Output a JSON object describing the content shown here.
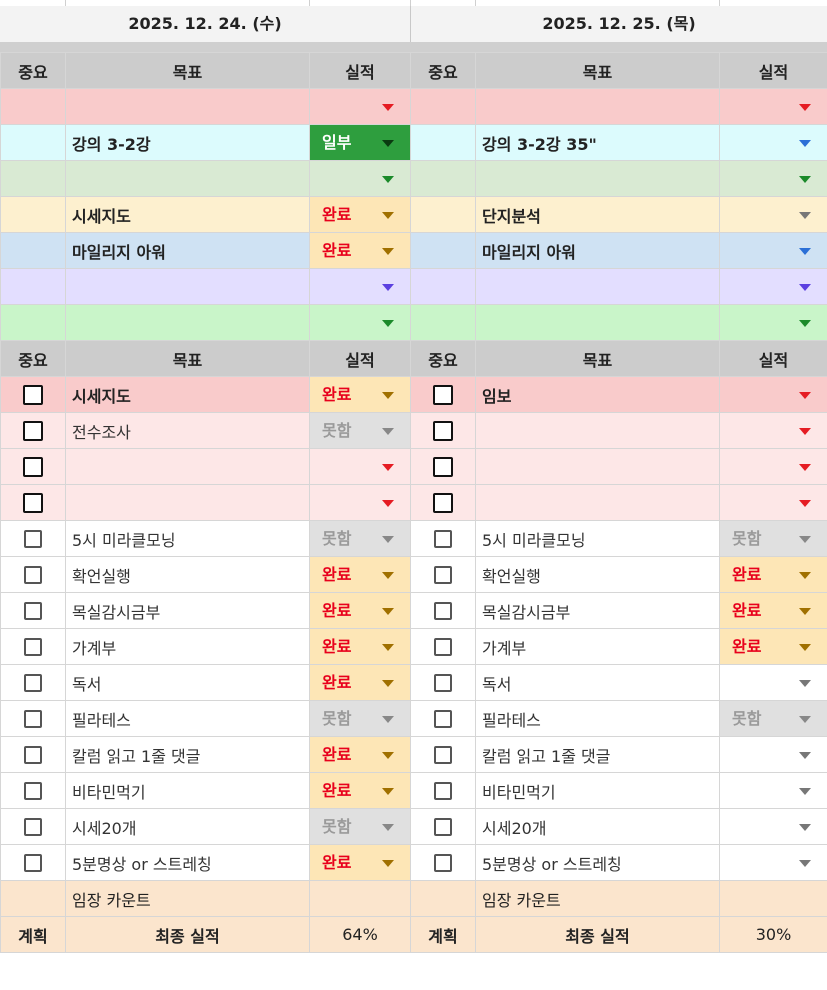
{
  "dates": [
    "2025. 12. 24. (수)",
    "2025. 12. 25. (목)"
  ],
  "headers": {
    "importance": "중요",
    "goal": "목표",
    "result": "실적"
  },
  "colors": {
    "red_row": "#f9cbcb",
    "cyan_row": "#dcfbfd",
    "green_row": "#d9ead3",
    "yellow_row": "#fdf0cf",
    "blue_row": "#cfe2f3",
    "purple_row": "#e3deff",
    "lightgreen_row": "#c9f5c9",
    "pink_row": "#fde7e7",
    "header_gray": "#cccccc",
    "footer": "#fbe5cd",
    "done_fill": "#fde6b6",
    "part_fill": "#2e9e3e"
  },
  "top_rows": [
    {
      "bg": "#f9cbcb",
      "day1": {
        "goal": "",
        "result": "",
        "arrow": "red"
      },
      "day2": {
        "goal": "",
        "result": "",
        "arrow": "red"
      }
    },
    {
      "bg": "#dcfbfd",
      "day1": {
        "goal": "강의 3-2강",
        "result": "일부",
        "arrow": "part"
      },
      "day2": {
        "goal": "강의 3-2강 35\"",
        "result": "",
        "arrow": "blue"
      }
    },
    {
      "bg": "#d9ead3",
      "day1": {
        "goal": "",
        "result": "",
        "arrow": "grn"
      },
      "day2": {
        "goal": "",
        "result": "",
        "arrow": "grn"
      }
    },
    {
      "bg": "#fdf0cf",
      "day1": {
        "goal": "시세지도",
        "result": "완료",
        "arrow": "done"
      },
      "day2": {
        "goal": "단지분석",
        "result": "",
        "arrow": "gray"
      }
    },
    {
      "bg": "#cfe2f3",
      "day1": {
        "goal": "마일리지 아워",
        "result": "완료",
        "arrow": "done"
      },
      "day2": {
        "goal": "마일리지 아워",
        "result": "",
        "arrow": "blue"
      }
    },
    {
      "bg": "#e3deff",
      "day1": {
        "goal": "",
        "result": "",
        "arrow": "pur"
      },
      "day2": {
        "goal": "",
        "result": "",
        "arrow": "pur"
      }
    },
    {
      "bg": "#c9f5c9",
      "day1": {
        "goal": "",
        "result": "",
        "arrow": "grn"
      },
      "day2": {
        "goal": "",
        "result": "",
        "arrow": "grn"
      }
    }
  ],
  "task_rows": [
    {
      "bg1": "#f9cbcb",
      "bg2": "#f9cbcb",
      "heavy": true,
      "bold": true,
      "day1": {
        "goal": "시세지도",
        "result": "완료",
        "arrow": "done"
      },
      "day2": {
        "goal": "임보",
        "result": "",
        "arrow": "red"
      }
    },
    {
      "bg1": "#fde7e7",
      "bg2": "#fde7e7",
      "heavy": true,
      "bold": false,
      "day1": {
        "goal": "전수조사",
        "result": "못함",
        "arrow": "fail"
      },
      "day2": {
        "goal": "",
        "result": "",
        "arrow": "red"
      }
    },
    {
      "bg1": "#fde7e7",
      "bg2": "#fde7e7",
      "heavy": true,
      "bold": false,
      "day1": {
        "goal": "",
        "result": "",
        "arrow": "red"
      },
      "day2": {
        "goal": "",
        "result": "",
        "arrow": "red"
      }
    },
    {
      "bg1": "#fde7e7",
      "bg2": "#fde7e7",
      "heavy": true,
      "bold": false,
      "day1": {
        "goal": "",
        "result": "",
        "arrow": "red"
      },
      "day2": {
        "goal": "",
        "result": "",
        "arrow": "red"
      }
    },
    {
      "bg1": "#ffffff",
      "bg2": "#ffffff",
      "heavy": false,
      "bold": false,
      "day1": {
        "goal": "5시 미라클모닝",
        "result": "못함",
        "arrow": "fail"
      },
      "day2": {
        "goal": "5시 미라클모닝",
        "result": "못함",
        "arrow": "fail"
      }
    },
    {
      "bg1": "#ffffff",
      "bg2": "#ffffff",
      "heavy": false,
      "bold": false,
      "day1": {
        "goal": "확언실행",
        "result": "완료",
        "arrow": "done"
      },
      "day2": {
        "goal": "확언실행",
        "result": "완료",
        "arrow": "done"
      }
    },
    {
      "bg1": "#ffffff",
      "bg2": "#ffffff",
      "heavy": false,
      "bold": false,
      "day1": {
        "goal": "목실감시금부",
        "result": "완료",
        "arrow": "done"
      },
      "day2": {
        "goal": "목실감시금부",
        "result": "완료",
        "arrow": "done"
      }
    },
    {
      "bg1": "#ffffff",
      "bg2": "#ffffff",
      "heavy": false,
      "bold": false,
      "day1": {
        "goal": "가계부",
        "result": "완료",
        "arrow": "done"
      },
      "day2": {
        "goal": "가계부",
        "result": "완료",
        "arrow": "done"
      }
    },
    {
      "bg1": "#ffffff",
      "bg2": "#ffffff",
      "heavy": false,
      "bold": false,
      "day1": {
        "goal": "독서",
        "result": "완료",
        "arrow": "done"
      },
      "day2": {
        "goal": "독서",
        "result": "",
        "arrow": "gray"
      }
    },
    {
      "bg1": "#ffffff",
      "bg2": "#ffffff",
      "heavy": false,
      "bold": false,
      "day1": {
        "goal": "필라테스",
        "result": "못함",
        "arrow": "fail"
      },
      "day2": {
        "goal": "필라테스",
        "result": "못함",
        "arrow": "fail"
      }
    },
    {
      "bg1": "#ffffff",
      "bg2": "#ffffff",
      "heavy": false,
      "bold": false,
      "day1": {
        "goal": "칼럼 읽고 1줄 댓글",
        "result": "완료",
        "arrow": "done"
      },
      "day2": {
        "goal": "칼럼 읽고 1줄 댓글",
        "result": "",
        "arrow": "gray"
      }
    },
    {
      "bg1": "#ffffff",
      "bg2": "#ffffff",
      "heavy": false,
      "bold": false,
      "day1": {
        "goal": "비타민먹기",
        "result": "완료",
        "arrow": "done"
      },
      "day2": {
        "goal": "비타민먹기",
        "result": "",
        "arrow": "gray"
      }
    },
    {
      "bg1": "#ffffff",
      "bg2": "#ffffff",
      "heavy": false,
      "bold": false,
      "day1": {
        "goal": "시세20개",
        "result": "못함",
        "arrow": "fail"
      },
      "day2": {
        "goal": "시세20개",
        "result": "",
        "arrow": "gray"
      }
    },
    {
      "bg1": "#ffffff",
      "bg2": "#ffffff",
      "heavy": false,
      "bold": false,
      "day1": {
        "goal": "5분명상 or  스트레칭",
        "result": "완료",
        "arrow": "done"
      },
      "day2": {
        "goal": "5분명상 or  스트레칭",
        "result": "",
        "arrow": "gray"
      }
    }
  ],
  "footer": {
    "count_label": "임장 카운트",
    "plan_label": "계획",
    "final_label": "최종 실적",
    "day1_rate": "64%",
    "day2_rate": "30%"
  }
}
